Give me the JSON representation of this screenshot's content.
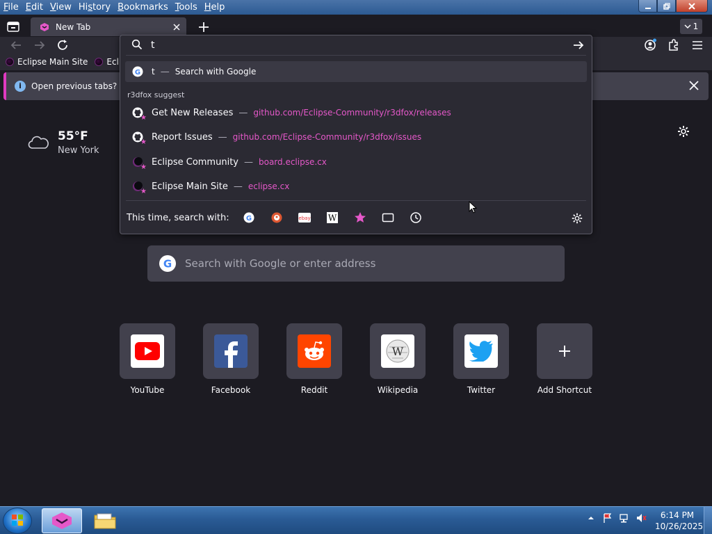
{
  "menu": {
    "items": [
      {
        "u": "F",
        "rest": "ile"
      },
      {
        "u": "E",
        "rest": "dit"
      },
      {
        "u": "V",
        "rest": "iew"
      },
      {
        "pre": "Hi",
        "u": "s",
        "rest": "tory"
      },
      {
        "u": "B",
        "rest": "ookmarks"
      },
      {
        "u": "T",
        "rest": "ools"
      },
      {
        "u": "H",
        "rest": "elp"
      }
    ]
  },
  "tabs": {
    "active_title": "New Tab",
    "tab_count": "1"
  },
  "bookmarks": [
    {
      "label": "Eclipse Main Site"
    },
    {
      "label": "Eclips"
    }
  ],
  "notification": {
    "text": "Open previous tabs? You"
  },
  "weather": {
    "temp": "55°F",
    "city": "New York"
  },
  "urlbar": {
    "value": "t",
    "search_result": {
      "title": "t",
      "subtitle": "Search with Google"
    },
    "suggest_heading": "r3dfox suggest",
    "suggestions": [
      {
        "title": "Get New Releases",
        "url": "github.com/Eclipse-Community/r3dfox/releases",
        "icon": "github-icon"
      },
      {
        "title": "Report Issues",
        "url": "github.com/Eclipse-Community/r3dfox/issues",
        "icon": "github-icon"
      },
      {
        "title": "Eclipse Community",
        "url": "board.eclipse.cx",
        "icon": "eclipse-icon"
      },
      {
        "title": "Eclipse Main Site",
        "url": "eclipse.cx",
        "icon": "eclipse-icon"
      }
    ],
    "oneoff_label": "This time, search with:",
    "engines": [
      "google-icon",
      "duckduckgo-icon",
      "ebay-icon",
      "wikipedia-icon",
      "bookmarks-star-icon",
      "tabs-icon",
      "history-icon"
    ]
  },
  "content_search": {
    "placeholder": "Search with Google or enter address"
  },
  "top_sites": [
    {
      "name": "YouTube",
      "icon": "youtube-icon",
      "color": "#ff0000"
    },
    {
      "name": "Facebook",
      "icon": "facebook-icon",
      "color": "#3b5998"
    },
    {
      "name": "Reddit",
      "icon": "reddit-icon",
      "color": "#ff4500"
    },
    {
      "name": "Wikipedia",
      "icon": "wikipedia-icon",
      "color": "#ffffff"
    },
    {
      "name": "Twitter",
      "icon": "twitter-icon",
      "color": "#1da1f2"
    },
    {
      "name": "Add Shortcut",
      "icon": "plus-icon",
      "color": "#42414d"
    }
  ],
  "taskbar": {
    "time": "6:14 PM",
    "date": "10/26/2025"
  },
  "colors": {
    "accent": "#e558c9",
    "background": "#1c1b22",
    "panel": "#42414d"
  }
}
